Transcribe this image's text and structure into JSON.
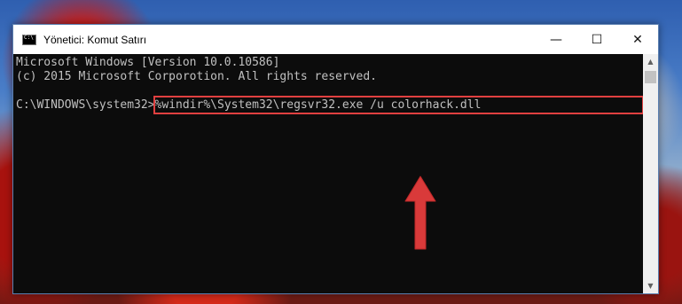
{
  "window": {
    "title": "Yönetici: Komut Satırı",
    "icon": "cmd-icon",
    "controls": {
      "minimize": "—",
      "maximize": "☐",
      "close": "✕"
    }
  },
  "console": {
    "lines": [
      "Microsoft Windows [Version 10.0.10586]",
      "(c) 2015 Microsoft Corporotion. All rights reserved.",
      "",
      "C:\\WINDOWS\\system32>%windir%\\System32\\regsvr32.exe /u colorhack.dll"
    ],
    "prompt": "C:\\WINDOWS\\system32>",
    "command": "%windir%\\System32\\regsvr32.exe /u colorhack.dll"
  },
  "scrollbar": {
    "up": "▲",
    "down": "▼"
  },
  "annotation": {
    "highlight_color": "#e04040",
    "arrow_icon": "red-up-arrow"
  }
}
